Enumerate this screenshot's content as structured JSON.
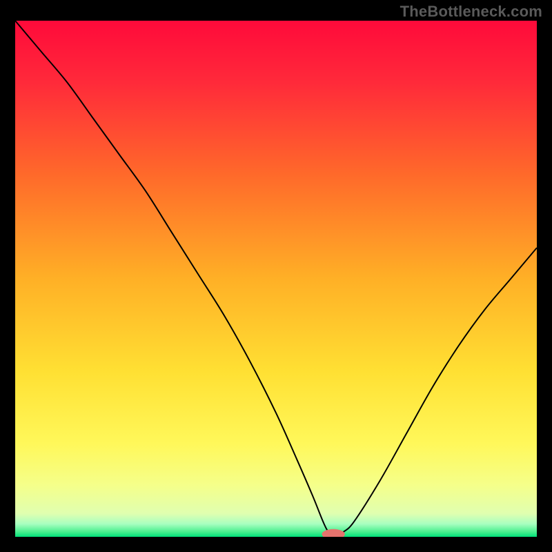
{
  "watermark": "TheBottleneck.com",
  "chart_data": {
    "type": "line",
    "title": "",
    "xlabel": "",
    "ylabel": "",
    "xlim": [
      0,
      100
    ],
    "ylim": [
      0,
      100
    ],
    "x": [
      0,
      5,
      10,
      15,
      20,
      25,
      30,
      35,
      40,
      45,
      50,
      54,
      57,
      59,
      60,
      61,
      62,
      63,
      65,
      70,
      75,
      80,
      85,
      90,
      95,
      100
    ],
    "values": [
      100,
      94,
      88,
      81,
      74,
      67,
      59,
      51,
      43,
      34,
      24,
      15,
      8,
      3,
      1,
      0.5,
      0.5,
      1,
      3,
      11,
      20,
      29,
      37,
      44,
      50,
      56
    ],
    "gradient_stops": [
      {
        "offset": 0.0,
        "color": "#ff0a3a"
      },
      {
        "offset": 0.12,
        "color": "#ff2a3a"
      },
      {
        "offset": 0.3,
        "color": "#ff6a2a"
      },
      {
        "offset": 0.5,
        "color": "#ffb026"
      },
      {
        "offset": 0.68,
        "color": "#ffe033"
      },
      {
        "offset": 0.82,
        "color": "#fff85a"
      },
      {
        "offset": 0.9,
        "color": "#f5ff8a"
      },
      {
        "offset": 0.955,
        "color": "#e0ffb0"
      },
      {
        "offset": 0.975,
        "color": "#a8ffc0"
      },
      {
        "offset": 0.99,
        "color": "#4cf090"
      },
      {
        "offset": 1.0,
        "color": "#00e07a"
      }
    ],
    "marker": {
      "x": 61,
      "y": 0.5,
      "color": "#e6736e",
      "rx": 2.2,
      "ry": 1.0
    }
  }
}
